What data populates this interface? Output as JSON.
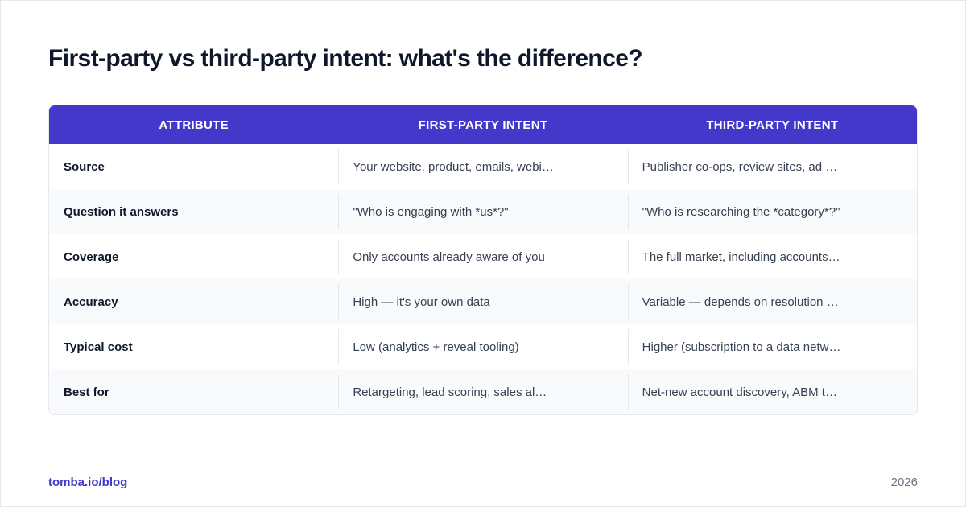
{
  "title": "First-party vs third-party intent: what's the difference?",
  "table": {
    "headers": [
      "ATTRIBUTE",
      "FIRST-PARTY INTENT",
      "THIRD-PARTY INTENT"
    ],
    "rows": [
      [
        "Source",
        "Your website, product, emails, webi…",
        "Publisher co-ops, review sites, ad …"
      ],
      [
        "Question it answers",
        "\"Who is engaging with *us*?\"",
        "\"Who is researching the *category*?\""
      ],
      [
        "Coverage",
        "Only accounts already aware of you",
        "The full market, including accounts…"
      ],
      [
        "Accuracy",
        "High — it's your own data",
        "Variable — depends on resolution qu…"
      ],
      [
        "Typical cost",
        "Low (analytics + reveal tooling)",
        "Higher (subscription to a data netw…"
      ],
      [
        "Best for",
        "Retargeting, lead scoring, sales al…",
        "Net-new account discovery, ABM targ…"
      ]
    ]
  },
  "footer": {
    "link": "tomba.io/blog",
    "year": "2026"
  },
  "colors": {
    "accent": "#4338ca",
    "title": "#0f172a",
    "muted": "#6b7280"
  }
}
